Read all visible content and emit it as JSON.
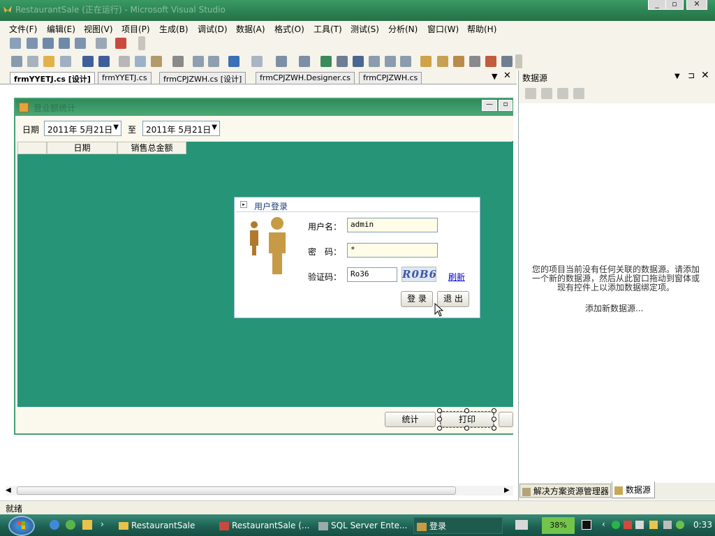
{
  "window": {
    "title": "RestaurantSale (正在运行) - Microsoft Visual Studio"
  },
  "menu": [
    "文件(F)",
    "编辑(E)",
    "视图(V)",
    "项目(P)",
    "生成(B)",
    "调试(D)",
    "数据(A)",
    "格式(O)",
    "工具(T)",
    "测试(S)",
    "分析(N)",
    "窗口(W)",
    "帮助(H)"
  ],
  "tabs": [
    "frmYYETJ.cs [设计]",
    "frmYYETJ.cs",
    "frmCPJZWH.cs [设计]",
    "frmCPJZWH.Designer.cs",
    "frmCPJZWH.cs"
  ],
  "form": {
    "title": "营业额统计",
    "date_label": "日期",
    "date_from": "2011年 5月21日",
    "to_label": "至",
    "date_to": "2011年 5月21日",
    "columns": [
      "日期",
      "销售总金额"
    ],
    "stats_button": "统计",
    "print_button": "打印"
  },
  "login": {
    "title": "用户登录",
    "username_label": "用户名：",
    "username": "admin",
    "password_label": "密　码：",
    "password": "*",
    "captcha_label": "验证码：",
    "captcha_input": "Ro36",
    "captcha_image": "R0B6",
    "refresh": "刷新",
    "login_button": "登 录",
    "exit_button": "退 出"
  },
  "datasource": {
    "title": "数据源",
    "message": "您的项目当前没有任何关联的数据源。请添加一个新的数据源，然后从此窗口拖动到窗体或现有控件上以添加数据绑定项。",
    "add_link": "添加新数据源...",
    "tab_solution": "解决方案资源管理器",
    "tab_datasource": "数据源"
  },
  "status": {
    "text": "就绪"
  },
  "taskbar": {
    "items": [
      "RestaurantSale",
      "RestaurantSale (...",
      "SQL Server Ente...",
      "登录"
    ],
    "battery": "38%",
    "clock": "0:33"
  },
  "colors": {
    "grid": "#269476",
    "title_bar": "#2d8353",
    "taskbar": "#1c5f50"
  }
}
